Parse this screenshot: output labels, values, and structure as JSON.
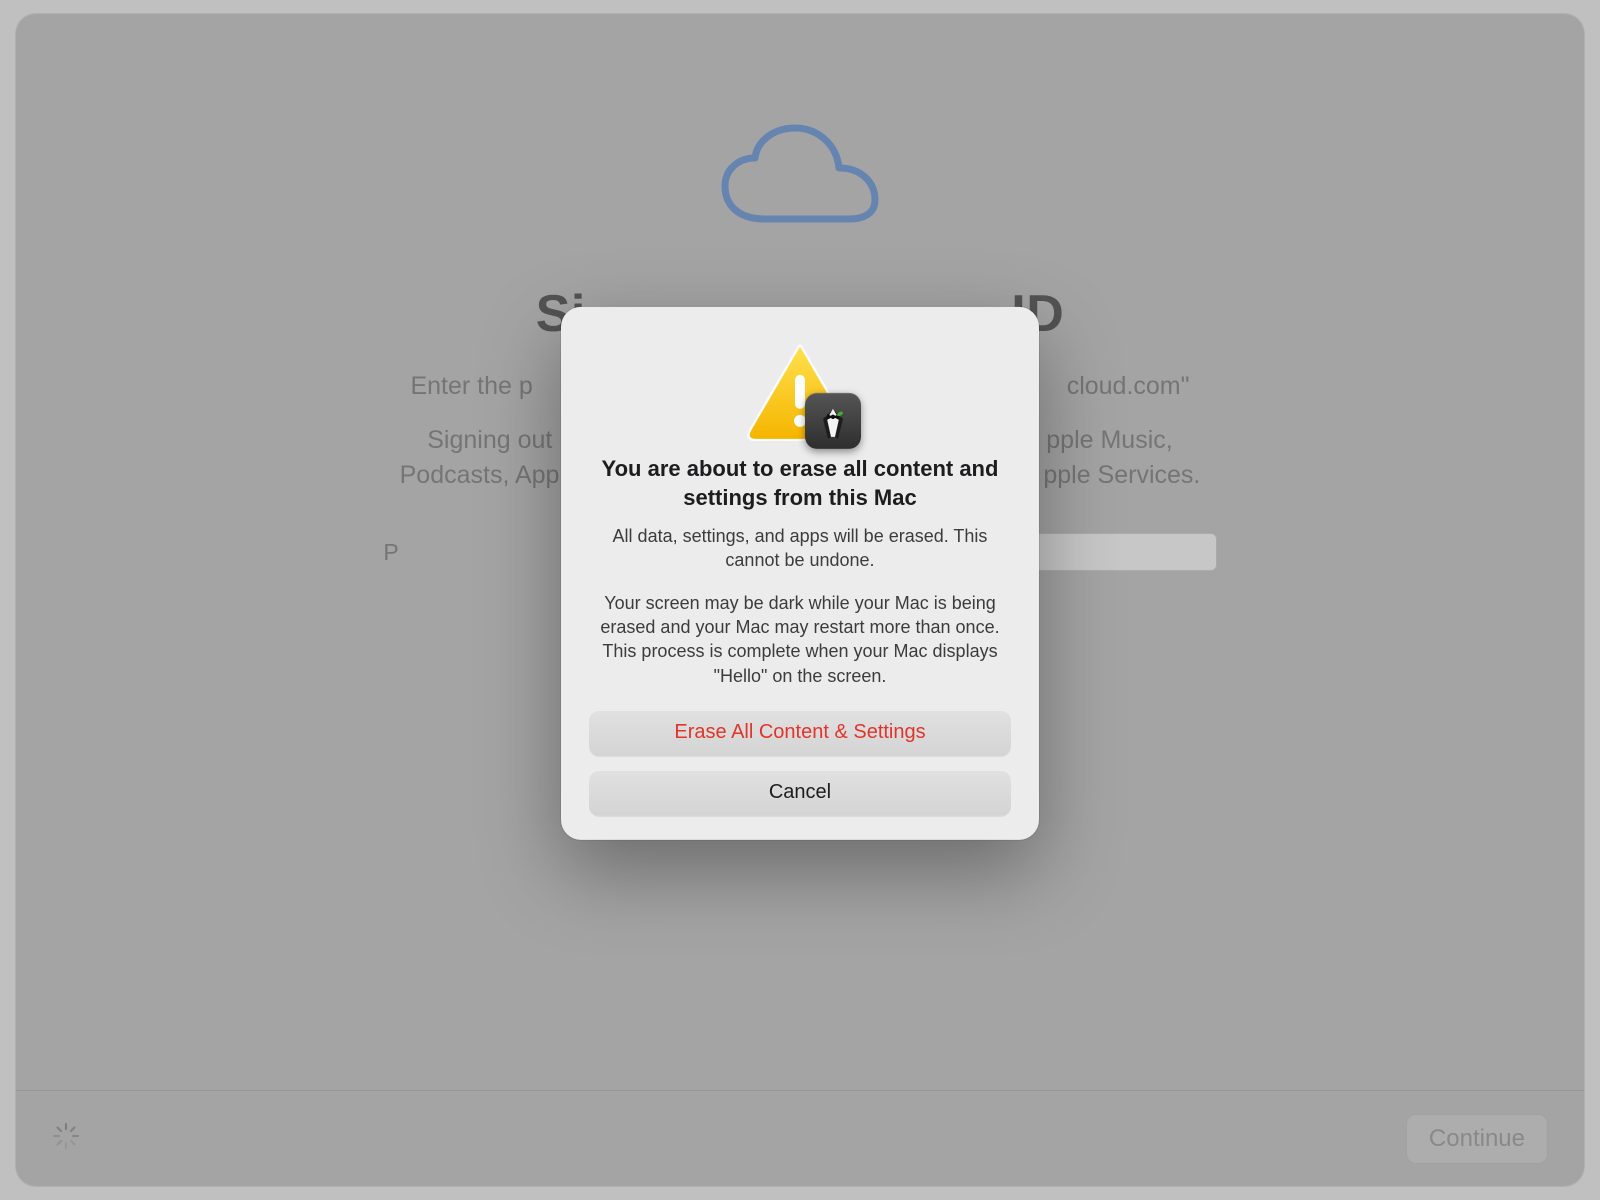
{
  "background": {
    "title_left": "Si",
    "title_right": "ID",
    "subtitle1_left": "Enter the p",
    "subtitle1_right": "cloud.com\"",
    "subtitle2_line1_left": "Signing out",
    "subtitle2_line1_right": "pple Music,",
    "subtitle2_line2_left": "Podcasts, App",
    "subtitle2_line2_right": "pple Services.",
    "password_label_left": "P"
  },
  "footer": {
    "continue_label": "Continue"
  },
  "modal": {
    "title": "You are about to erase all content and settings from this Mac",
    "body1": "All data, settings, and apps will be erased. This cannot be undone.",
    "body2": "Your screen may be dark while your Mac is being erased and your Mac may restart more than once. This process is complete when your Mac displays \"Hello\" on the screen.",
    "erase_label": "Erase All Content & Settings",
    "cancel_label": "Cancel"
  }
}
